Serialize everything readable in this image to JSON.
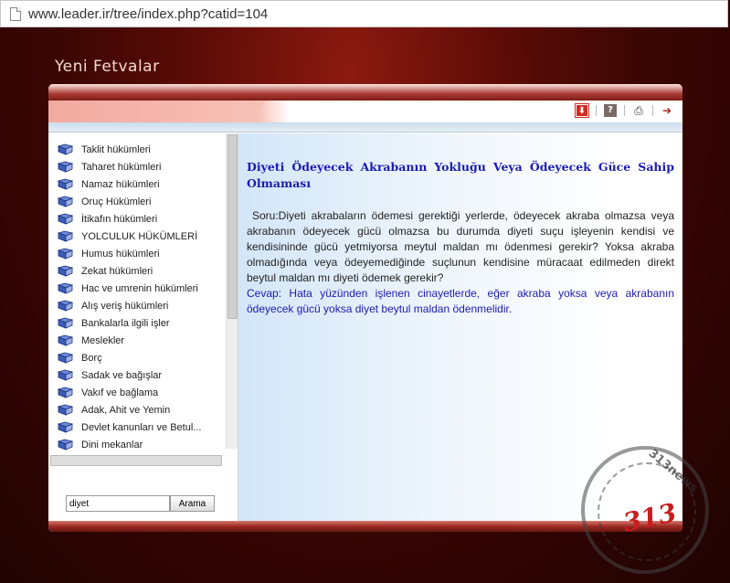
{
  "browser": {
    "url": "www.leader.ir/tree/index.php?catid=104"
  },
  "page": {
    "section_title": "Yeni Fetvalar"
  },
  "toolbar": {
    "icons": [
      "download-icon",
      "help-icon",
      "print-icon",
      "next-arrow-icon"
    ]
  },
  "sidebar": {
    "items": [
      "Taklit hükümleri",
      "Taharet hükümleri",
      "Namaz hükümleri",
      "Oruç Hükümleri",
      "İtikafın hükümleri",
      "YOLCULUK HÜKÜMLERİ",
      "Humus hükümleri",
      "Zekat hükümleri",
      "Hac ve umrenin hükümleri",
      "Alış veriş hükümleri",
      "Bankalarla ilgili işler",
      "Meslekler",
      "Borç",
      "Sadak ve bağışlar",
      "Vakıf ve bağlama",
      "Adak, Ahit ve Yemin",
      "Devlet kanunları ve Betul...",
      "Dini mekanlar"
    ],
    "search_value": "diyet",
    "search_button": "Arama"
  },
  "article": {
    "title": "Diyeti Ödeyecek Akrabanın Yokluğu Veya Ödeyecek Güce Sahip Olmaması",
    "question": "Soru:Diyeti akrabaların ödemesi gerektiği yerlerde, ödeyecek akraba olmazsa veya akrabanın ödeyecek gücü olmazsa bu durumda diyeti suçu işleyenin kendisi ve kendisininde gücü yetmiyorsa meytul maldan mı ödenmesi gerekir? Yoksa akraba olmadığında veya ödeyemediğinde suçlunun kendisine müracaat edilmeden direkt beytul maldan mı diyeti ödemek gerekir?",
    "answer": "Cevap: Hata yüzünden işlenen cinayetlerde, eğer akraba yoksa veya akrabanın ödeyecek gücü yoksa diyet beytul maldan ödenmelidir."
  },
  "watermark": {
    "number": "313",
    "text": "313news"
  },
  "colors": {
    "title_blue": "#1b1bb3",
    "brand_red": "#8c1a10"
  }
}
